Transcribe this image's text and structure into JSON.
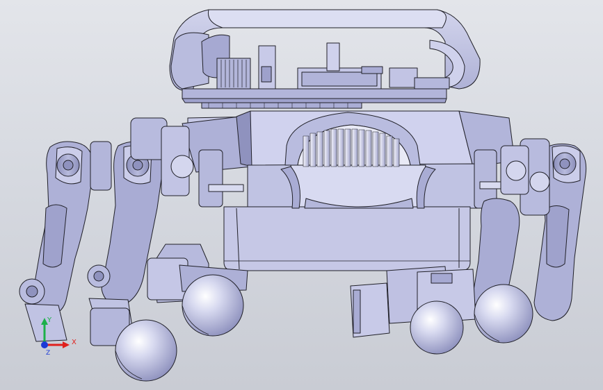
{
  "view": {
    "background_top": "#e3e5ea",
    "background_bottom": "#c9ccd4",
    "part_color": "#c3c5e0",
    "part_shade": "#9c9fc6",
    "edge_color": "#202028"
  },
  "triad": {
    "x_label": "X",
    "y_label": "Y",
    "z_label": "Z",
    "x_color": "#e0201c",
    "y_color": "#1cb04a",
    "z_color": "#1c3ad6"
  }
}
